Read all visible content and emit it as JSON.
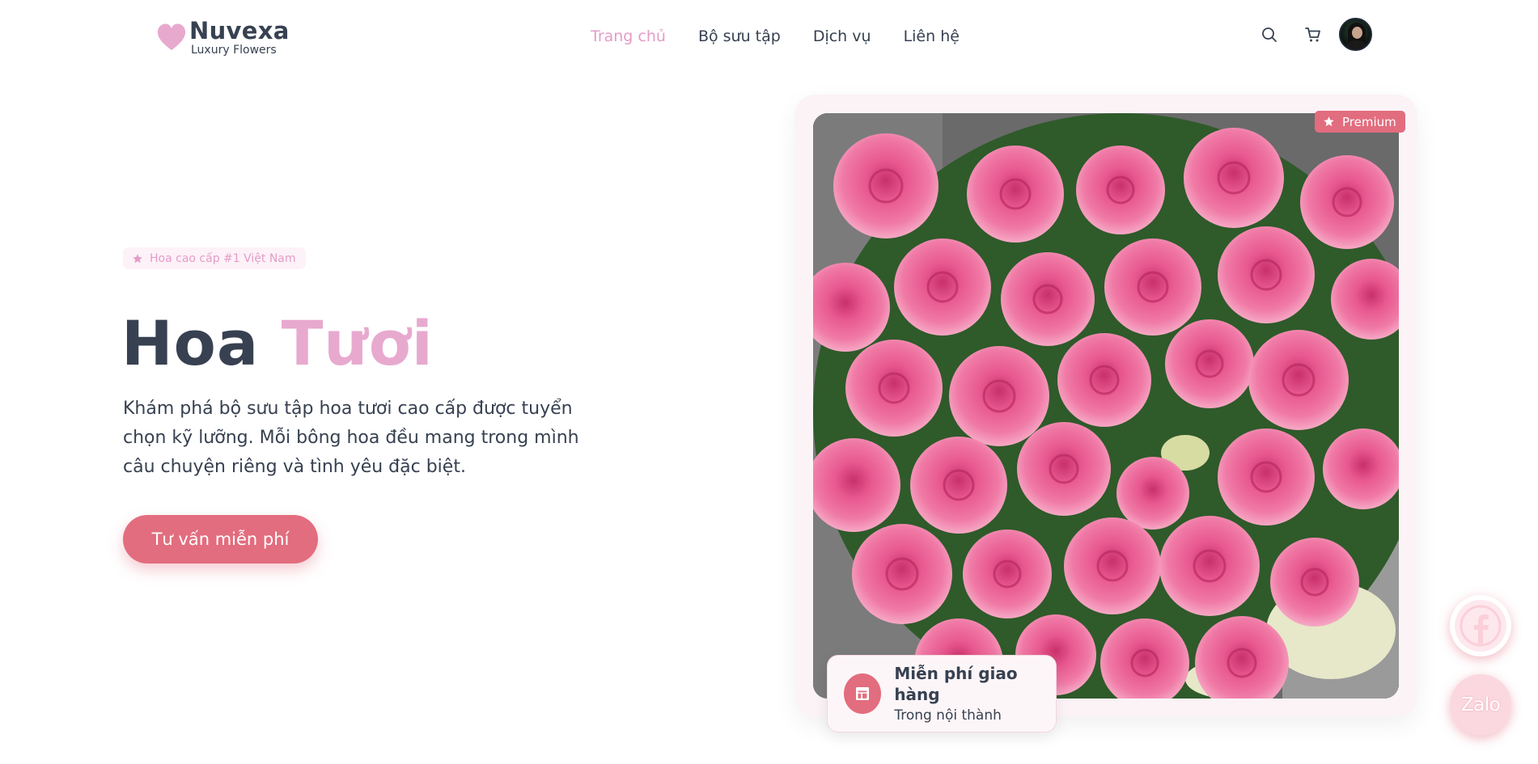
{
  "brand": {
    "name": "Nuvexa",
    "tagline": "Luxury Flowers"
  },
  "nav": {
    "items": [
      {
        "label": "Trang chủ",
        "active": true
      },
      {
        "label": "Bộ sưu tập",
        "active": false
      },
      {
        "label": "Dịch vụ",
        "active": false
      },
      {
        "label": "Liên hệ",
        "active": false
      }
    ]
  },
  "header_actions": {
    "icons": [
      "search-icon",
      "cart-icon",
      "avatar"
    ]
  },
  "hero": {
    "badge": "Hoa cao cấp #1 Việt Nam",
    "title_part1": "Hoa",
    "title_part2": "Tươi",
    "description": "Khám phá bộ sưu tập hoa tươi cao cấp được tuyển chọn kỹ lưỡng. Mỗi bông hoa đều mang trong mình câu chuyện riêng và tình yêu đặc biệt.",
    "cta": "Tư vấn miễn phí"
  },
  "showcase": {
    "premium_label": "Premium",
    "delivery_title": "Miễn phí giao hàng",
    "delivery_subtitle": "Trong nội thành"
  },
  "social": {
    "zalo_label": "Zalo"
  },
  "colors": {
    "accent": "#e26d7e",
    "pink_light": "#e8a9cf",
    "text": "#374151"
  }
}
